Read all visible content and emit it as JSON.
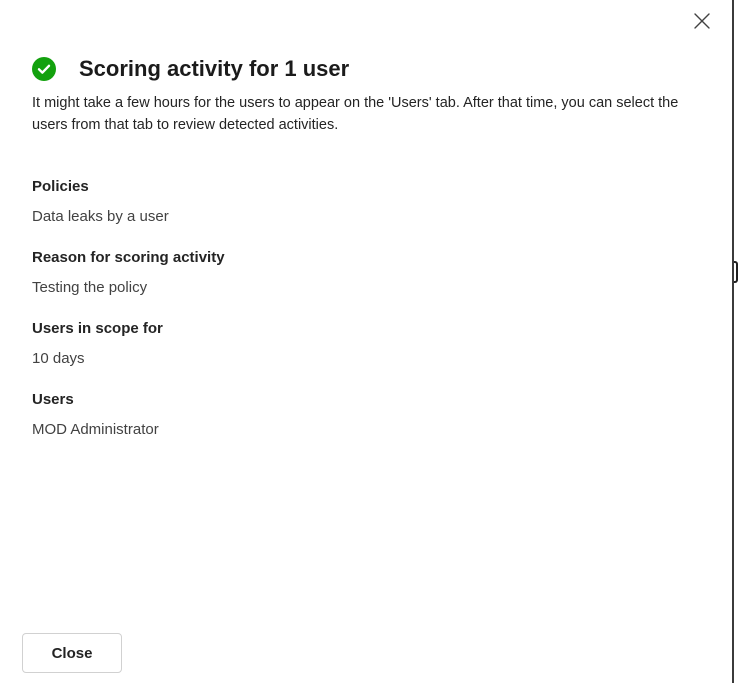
{
  "panel": {
    "title": "Scoring activity for 1 user",
    "description": "It might take a few hours for the users to appear on the 'Users' tab. After that time, you can select the users from that tab to review detected activities.",
    "status_icon": "check-circle-icon",
    "status_color": "#13a10e",
    "dismiss_icon": "close-icon"
  },
  "fields": [
    {
      "label": "Policies",
      "value": "Data leaks by a user"
    },
    {
      "label": "Reason for scoring activity",
      "value": "Testing the policy"
    },
    {
      "label": "Users in scope for",
      "value": "10 days"
    },
    {
      "label": "Users",
      "value": "MOD Administrator"
    }
  ],
  "footer": {
    "close_label": "Close"
  }
}
